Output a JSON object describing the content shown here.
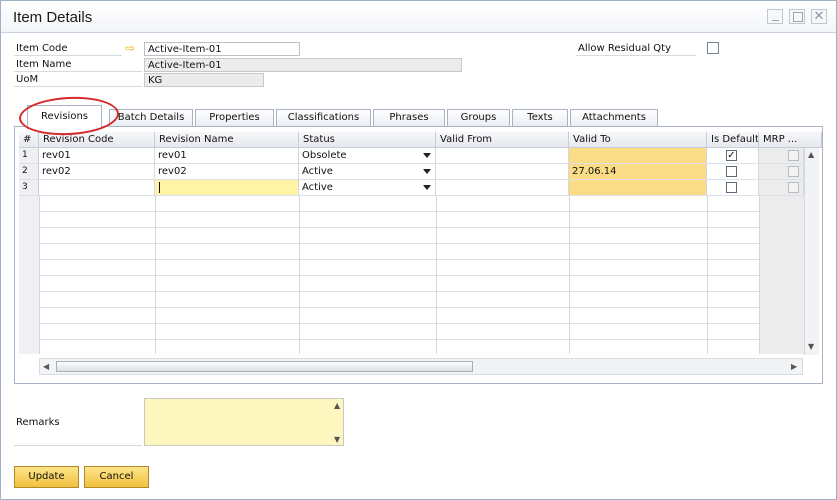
{
  "window": {
    "title": "Item Details",
    "close_glyph": "✕"
  },
  "header": {
    "item_code_label": "Item Code",
    "item_code_value": "Active-Item-01",
    "item_name_label": "Item Name",
    "item_name_value": "Active-Item-01",
    "uom_label": "UoM",
    "uom_value": "KG",
    "allow_residual_label": "Allow Residual Qty",
    "allow_residual_checked": false
  },
  "tabs": [
    {
      "label": "Revisions",
      "active": true
    },
    {
      "label": "Batch Details"
    },
    {
      "label": "Properties"
    },
    {
      "label": "Classifications"
    },
    {
      "label": "Phrases"
    },
    {
      "label": "Groups"
    },
    {
      "label": "Texts"
    },
    {
      "label": "Attachments"
    }
  ],
  "grid": {
    "columns": [
      "#",
      "Revision Code",
      "Revision Name",
      "Status",
      "Valid From",
      "Valid To",
      "Is Default",
      "MRP ..."
    ],
    "rows": [
      {
        "num": "1",
        "code": "rev01",
        "name": "rev01",
        "status": "Obsolete",
        "valid_from": "",
        "valid_to": "",
        "is_default": "✓"
      },
      {
        "num": "2",
        "code": "rev02",
        "name": "rev02",
        "status": "Active",
        "valid_from": "",
        "valid_to": "27.06.14",
        "is_default": ""
      },
      {
        "num": "3",
        "code": "",
        "name": "",
        "status": "Active",
        "valid_from": "",
        "valid_to": "",
        "is_default": ""
      }
    ]
  },
  "remarks_label": "Remarks",
  "buttons": {
    "update": "Update",
    "cancel": "Cancel"
  },
  "colors": {
    "accent_yellow": "#f1c23d",
    "highlight_orange": "#fbdc86",
    "annotation_red": "#d62a2a"
  }
}
